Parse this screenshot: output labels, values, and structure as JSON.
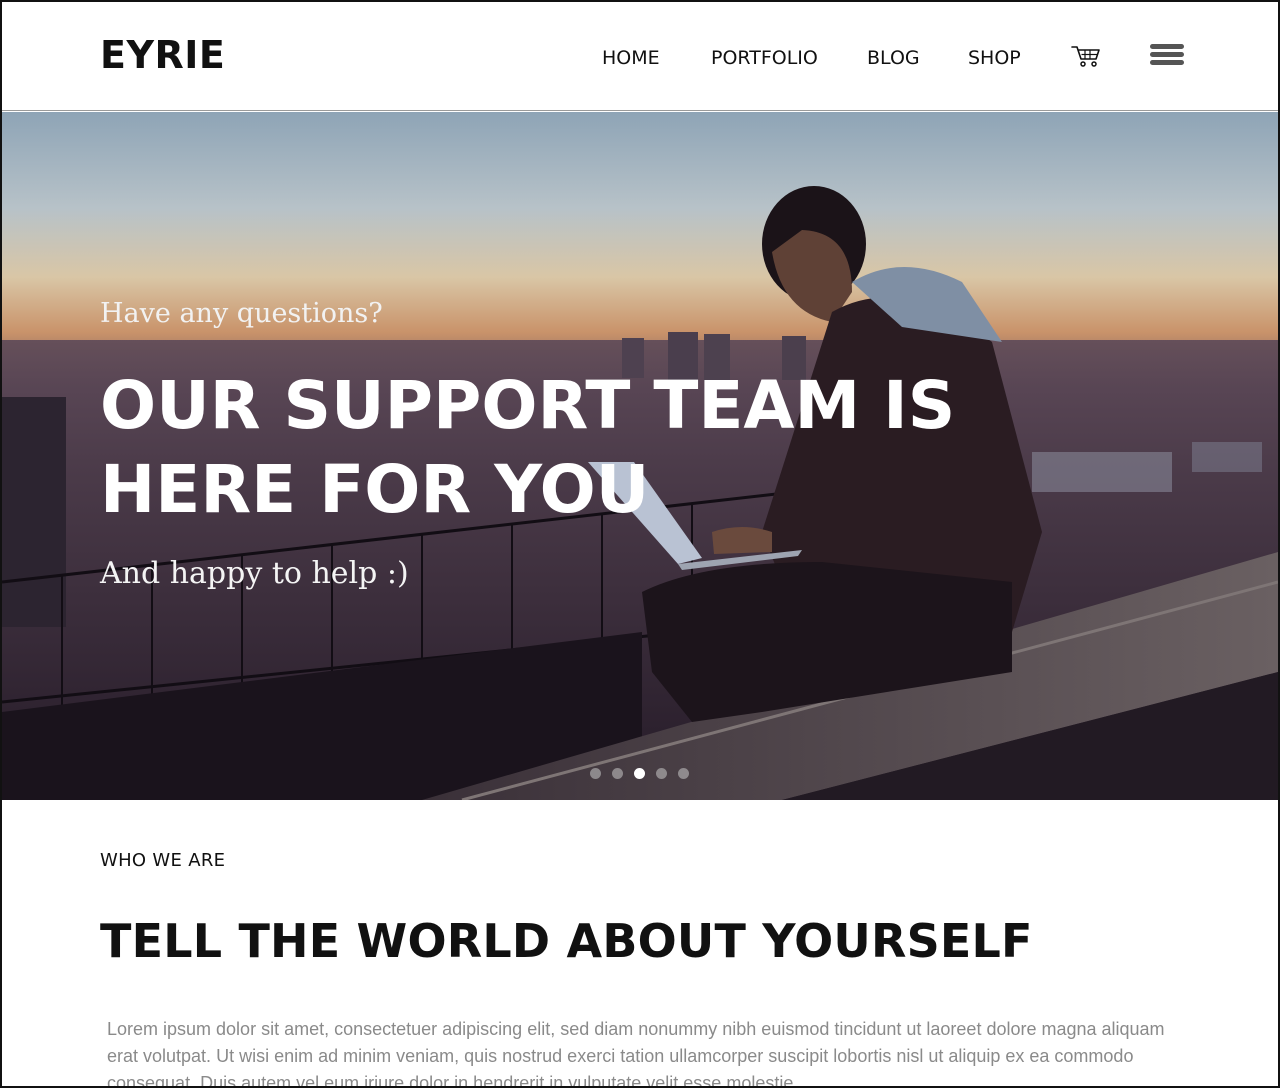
{
  "brand": {
    "name": "EYRIE"
  },
  "nav": {
    "items": [
      {
        "label": "HOME"
      },
      {
        "label": "PORTFOLIO"
      },
      {
        "label": "BLOG"
      },
      {
        "label": "SHOP"
      }
    ],
    "cart_icon": "cart-icon",
    "menu_icon": "hamburger-menu-icon"
  },
  "hero": {
    "kicker": "Have any questions?",
    "title": "OUR SUPPORT TEAM IS HERE FOR YOU",
    "subtitle": "And happy to help :)",
    "slide_count": 5,
    "active_slide": 3
  },
  "about": {
    "label": "WHO WE ARE",
    "title": "TELL THE WORLD ABOUT YOURSELF",
    "body": "Lorem ipsum dolor sit amet, consectetuer adipiscing elit, sed diam nonummy nibh euismod tincidunt ut laoreet dolore magna aliquam erat volutpat. Ut wisi enim ad minim veniam, quis nostrud exerci tation ullamcorper suscipit lobortis nisl ut aliquip ex ea commodo consequat. Duis autem vel eum iriure dolor in hendrerit in vulputate velit esse molestie"
  },
  "colors": {
    "text": "#111111",
    "muted_text": "#8a8a8a",
    "hero_text": "#ffffff"
  }
}
